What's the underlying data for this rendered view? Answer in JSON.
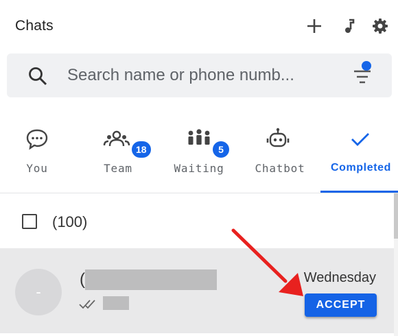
{
  "header": {
    "title": "Chats",
    "icons": [
      "plus-icon",
      "music-note-icon",
      "gear-icon"
    ]
  },
  "search": {
    "placeholder": "Search name or phone numb...",
    "value": "",
    "filter_icon": "filter-icon"
  },
  "tabs": [
    {
      "label": "You",
      "icon": "chat-bubble-icon",
      "badge": ""
    },
    {
      "label": "Team",
      "icon": "team-icon",
      "badge": "18"
    },
    {
      "label": "Waiting",
      "icon": "people-waiting-icon",
      "badge": "5"
    },
    {
      "label": "Chatbot",
      "icon": "robot-icon",
      "badge": ""
    },
    {
      "label": "Completed",
      "icon": "check-icon",
      "badge": "",
      "active": true
    }
  ],
  "list": {
    "select_all_count": "(100)",
    "items": [
      {
        "avatar_initial": "-",
        "name_prefix": "(",
        "time": "Wednesday",
        "status_icon": "double-check-icon",
        "action_label": "ACCEPT"
      }
    ]
  },
  "annotation": {
    "arrow_color": "#e8211f"
  },
  "colors": {
    "accent": "#1565e8",
    "item_background": "#e9e9ea"
  }
}
